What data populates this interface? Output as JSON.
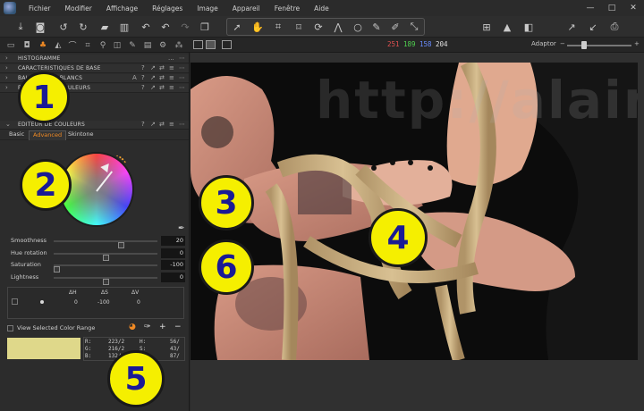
{
  "menu": {
    "items": [
      "Fichier",
      "Modifier",
      "Affichage",
      "Réglages",
      "Image",
      "Appareil",
      "Fenêtre",
      "Aide"
    ],
    "window_controls": [
      "—",
      "□",
      "✕"
    ]
  },
  "toolbar": {
    "left_icons": [
      "download-icon",
      "camera-icon",
      "rotate-left-icon",
      "rotate-right-icon",
      "folder-export-icon",
      "trash-icon",
      "undo-icon",
      "undo-icon",
      "redo-icon",
      "copy-icon"
    ],
    "cursor_tools": [
      "pointer-icon",
      "hand-icon",
      "crop-icon",
      "crop-icon",
      "rotate-icon",
      "keystone-icon",
      "circle-mask-icon",
      "brush-icon",
      "eraser-icon",
      "picker-icon"
    ],
    "right_icons": [
      "grid-icon",
      "warning-icon",
      "exposure-icon",
      "arrow-up-right-icon",
      "arrow-down-left-icon",
      "print-icon"
    ]
  },
  "tool_tabs": [
    "folder-icon",
    "camera-icon",
    "color-tab-icon",
    "lens-icon",
    "crop-icon",
    "search-icon",
    "layers-icon",
    "brush-icon",
    "info-icon",
    "adjust-icon",
    "gear-icon",
    "batch-icon"
  ],
  "rgb_readout": {
    "r": "251",
    "g": "189",
    "b": "158",
    "l": "204"
  },
  "rgb_colors": {
    "r": "#e05050",
    "g": "#50d050",
    "b": "#6a8cff",
    "l": "#e0e0e0"
  },
  "adaptor_label": "Adaptor",
  "zoom_minus": "−",
  "zoom_plus": "+",
  "sections": [
    {
      "title": "HISTOGRAMME",
      "icons": [
        "...",
        "⋯"
      ]
    },
    {
      "title": "CARACTÉRISTIQUES DE BASE",
      "icons": [
        "?",
        "↗",
        "⇄",
        "≡",
        "⋯"
      ]
    },
    {
      "title": "BALANCE DES BLANCS",
      "icons": [
        "A",
        "?",
        "↗",
        "⇄",
        "≡",
        "⋯"
      ]
    },
    {
      "title": "BALANCE DES COULEURS",
      "icons": [
        "?",
        "↗",
        "⇄",
        "≡",
        "⋯"
      ]
    },
    {
      "title": "ÉDITEUR DE COULEURS",
      "icons": [
        "?",
        "↗",
        "⇄",
        "≡",
        "⋯"
      ]
    }
  ],
  "color_editor": {
    "tabs": [
      "Basic",
      "Advanced",
      "Skintone"
    ],
    "active_tab": "Advanced",
    "sliders": [
      {
        "label": "Smoothness",
        "value": "20",
        "level": 0.66
      },
      {
        "label": "Hue rotation",
        "value": "0",
        "level": 0.5
      },
      {
        "label": "Saturation",
        "value": "-100",
        "level": 0.0
      },
      {
        "label": "Lightness",
        "value": "0",
        "level": 0.5
      }
    ],
    "table": {
      "headers": [
        "ΔH",
        "ΔS",
        "ΔV"
      ],
      "row": [
        "0",
        "-100",
        "0"
      ]
    },
    "view_selected_label": "View Selected Color Range",
    "range_tools": [
      "color-range-icon",
      "picker-plus-icon",
      "+",
      "−"
    ],
    "swatch_color": "#dfd88a",
    "values": {
      "r": "223/2",
      "g": "216/2",
      "b": "132/",
      "h": "56/",
      "s": "43/",
      "l": "87/"
    },
    "value_labels": {
      "r": "R:",
      "g": "G:",
      "b": "B:",
      "h": "H:",
      "s": "S:",
      "l": "L:"
    }
  },
  "watermark": "http://alainpre.free.fr",
  "callouts": [
    "1",
    "2",
    "3",
    "4",
    "5",
    "6"
  ],
  "accent": "#f08a24",
  "callout_color": "#f5ef00",
  "callout_text_color": "#1a1a95"
}
